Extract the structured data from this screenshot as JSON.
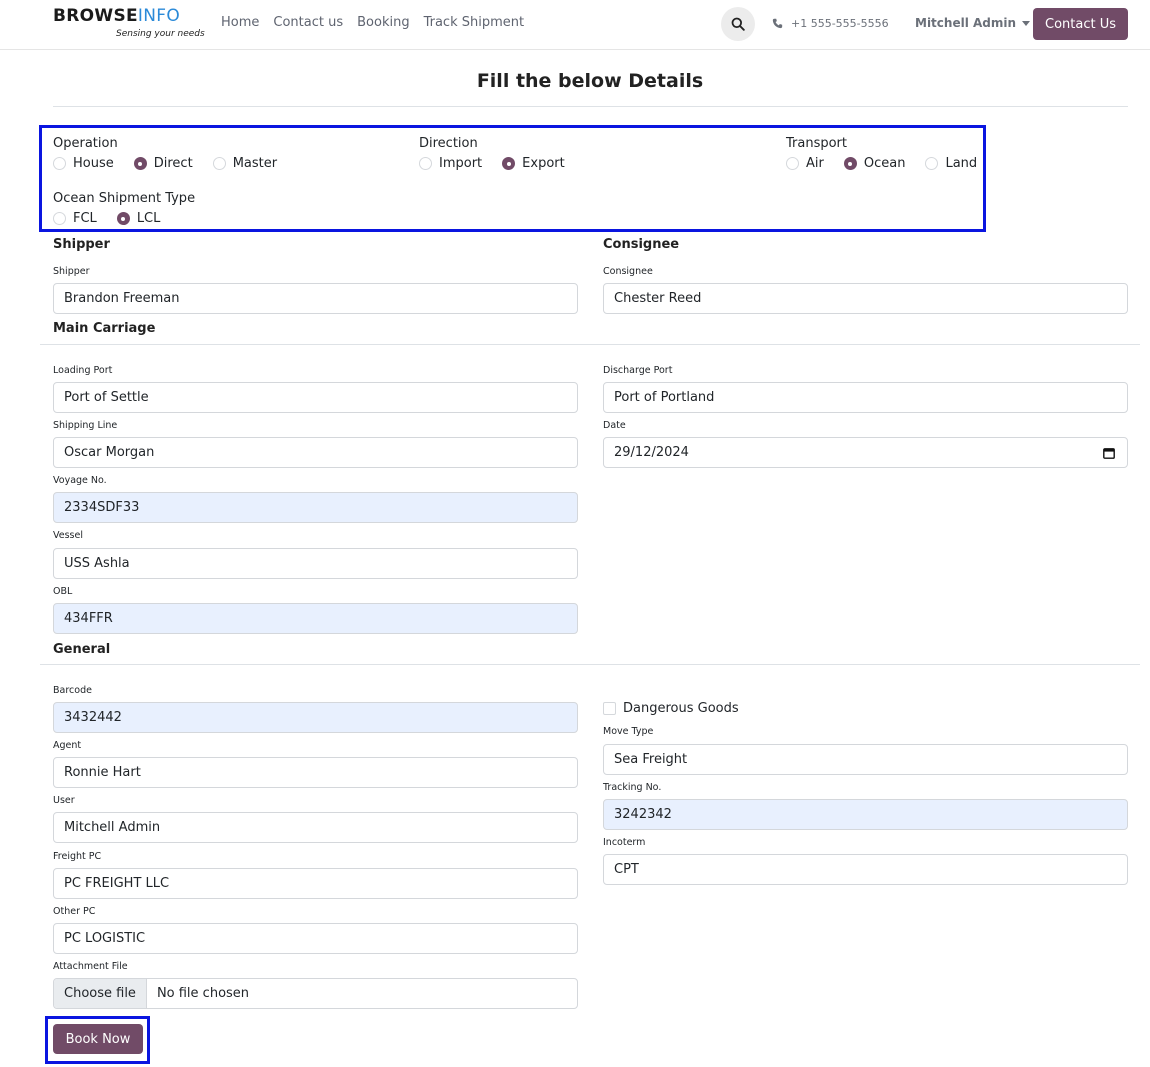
{
  "header": {
    "logo": {
      "part1": "BROWSE",
      "part2": "INFO",
      "tagline": "Sensing your needs"
    },
    "nav": [
      "Home",
      "Contact us",
      "Booking",
      "Track Shipment"
    ],
    "phone": "+1 555-555-5556",
    "user": "Mitchell Admin",
    "contact_button": "Contact Us",
    "icons": {
      "search": "search-icon",
      "phone": "phone-icon",
      "user_caret": "chevron-down-icon"
    }
  },
  "page": {
    "title": "Fill the below Details"
  },
  "options": {
    "operation": {
      "label": "Operation",
      "choices": [
        "House",
        "Direct",
        "Master"
      ],
      "selected": "Direct"
    },
    "direction": {
      "label": "Direction",
      "choices": [
        "Import",
        "Export"
      ],
      "selected": "Export"
    },
    "transport": {
      "label": "Transport",
      "choices": [
        "Air",
        "Ocean",
        "Land"
      ],
      "selected": "Ocean"
    },
    "ocean_type": {
      "label": "Ocean Shipment Type",
      "choices": [
        "FCL",
        "LCL"
      ],
      "selected": "LCL"
    }
  },
  "sections": {
    "shipper": "Shipper",
    "consignee": "Consignee",
    "main_carriage": "Main Carriage",
    "general": "General"
  },
  "fields": {
    "shipper": {
      "label": "Shipper",
      "value": "Brandon Freeman"
    },
    "consignee": {
      "label": "Consignee",
      "value": "Chester Reed"
    },
    "loading_port": {
      "label": "Loading Port",
      "value": "Port of Settle"
    },
    "discharge_port": {
      "label": "Discharge Port",
      "value": "Port of Portland"
    },
    "shipping_line": {
      "label": "Shipping Line",
      "value": "Oscar Morgan"
    },
    "date": {
      "label": "Date",
      "value": "29/12/2024"
    },
    "voyage_no": {
      "label": "Voyage No.",
      "value": "2334SDF33"
    },
    "vessel": {
      "label": "Vessel",
      "value": "USS Ashla"
    },
    "obl": {
      "label": "OBL",
      "value": "434FFR"
    },
    "barcode": {
      "label": "Barcode",
      "value": "3432442"
    },
    "agent": {
      "label": "Agent",
      "value": "Ronnie Hart"
    },
    "user": {
      "label": "User",
      "value": "Mitchell Admin"
    },
    "freight_pc": {
      "label": "Freight PC",
      "value": "PC FREIGHT LLC"
    },
    "other_pc": {
      "label": "Other PC",
      "value": "PC LOGISTIC"
    },
    "attachment": {
      "label": "Attachment File",
      "button": "Choose file",
      "status": "No file chosen"
    },
    "dangerous_goods": {
      "label": "Dangerous Goods",
      "checked": false
    },
    "move_type": {
      "label": "Move Type",
      "value": "Sea Freight"
    },
    "tracking_no": {
      "label": "Tracking No.",
      "value": "3242342"
    },
    "incoterm": {
      "label": "Incoterm",
      "value": "CPT"
    }
  },
  "actions": {
    "book_now": "Book Now"
  },
  "colors": {
    "brand": "#714b67",
    "highlight": "#0a15e0",
    "autofill": "#e8f0fe"
  }
}
